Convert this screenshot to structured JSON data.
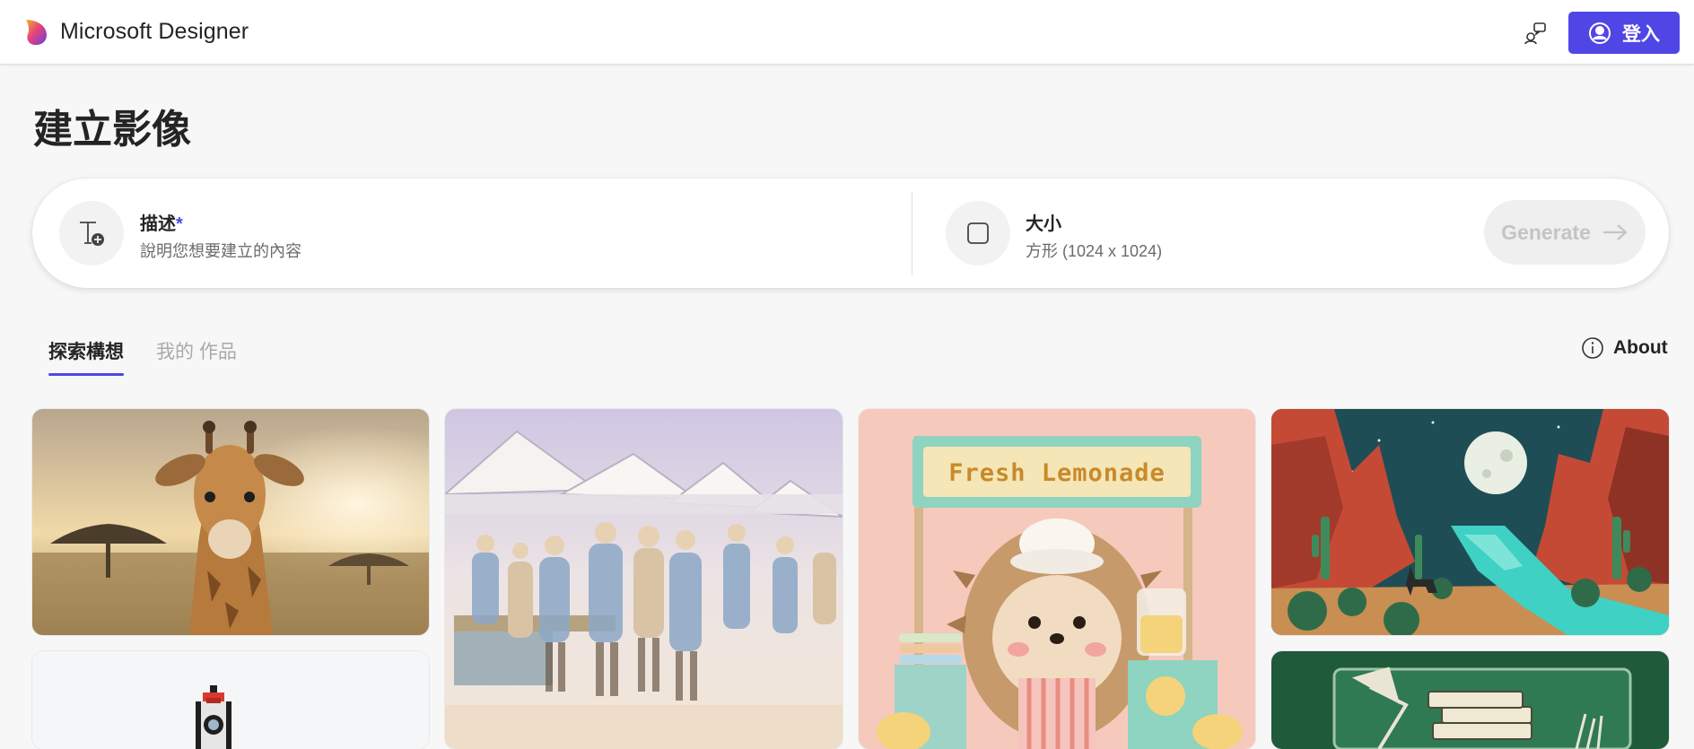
{
  "header": {
    "brand": "Microsoft Designer",
    "signin_label": "登入"
  },
  "page": {
    "title": "建立影像"
  },
  "prompt": {
    "description_label": "描述",
    "description_required": "*",
    "description_placeholder": "說明您想要建立的內容",
    "size_label": "大小",
    "size_value": "方形 (1024 x 1024)",
    "generate_label": "Generate"
  },
  "tabs": [
    {
      "label": "探索構想",
      "active": true
    },
    {
      "label": "我的 作品",
      "active": false
    }
  ],
  "about_label": "About",
  "gallery": {
    "lemonade_sign": "Fresh Lemonade",
    "items": [
      {
        "subject": "giraffe-savanna"
      },
      {
        "subject": "watercolor-market"
      },
      {
        "subject": "hedgehog-lemonade-stand"
      },
      {
        "subject": "lowpoly-canyon-coyote"
      },
      {
        "subject": "pixel-rocket"
      },
      {
        "subject": "desk-lamp-books"
      }
    ]
  },
  "colors": {
    "accent": "#4f46e5",
    "background": "#f7f7f8",
    "generate_disabled_bg": "#efefef",
    "generate_disabled_text": "#c4c4c4"
  },
  "icons": {
    "logo": "designer-logo",
    "help": "help-chat-icon",
    "account": "account-circle-icon",
    "description": "text-add-icon",
    "size": "square-icon",
    "arrow": "arrow-right-icon",
    "info": "info-icon"
  }
}
